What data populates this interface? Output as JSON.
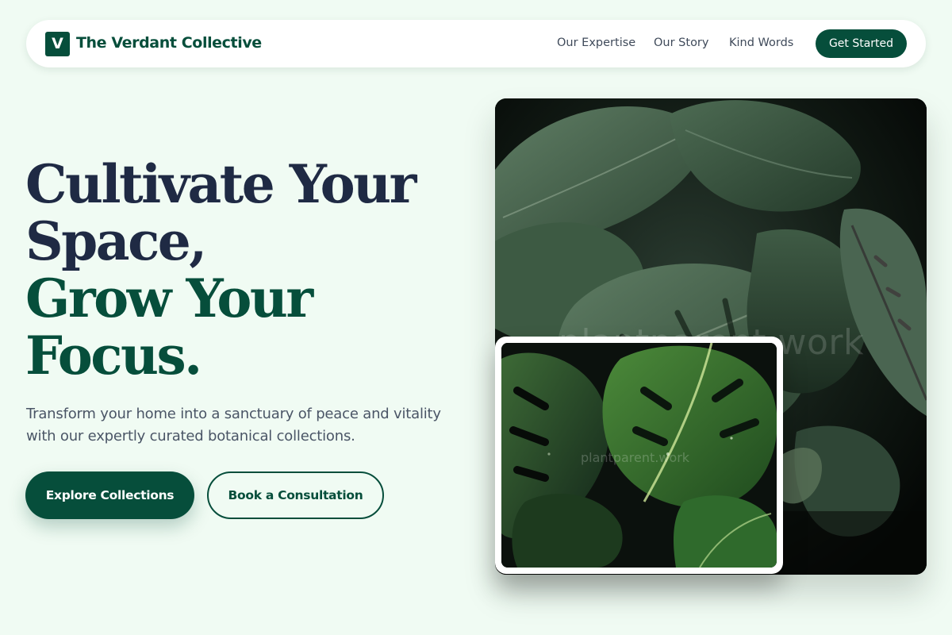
{
  "brand": {
    "logo_letter": "V",
    "name": "The Verdant Collective"
  },
  "nav": {
    "links": [
      "Our Expertise",
      "Our Story",
      "Kind Words"
    ],
    "cta_label": "Get Started"
  },
  "hero": {
    "headline_lines": [
      "Cultivate Your",
      "Space,",
      "Grow Your",
      "Focus."
    ],
    "subtext": "Transform your home into a sanctuary of peace and vitality with our expertly curated botanical collections.",
    "primary_cta": "Explore Collections",
    "secondary_cta": "Book a Consultation"
  },
  "images": {
    "main_watermark": "plantparent.work",
    "inset_watermark": "plantparent.work"
  },
  "colors": {
    "background": "#f0fbf3",
    "brand_green": "#064e3b",
    "headline_dark": "#1f2a44",
    "body_text": "#4a5566"
  }
}
